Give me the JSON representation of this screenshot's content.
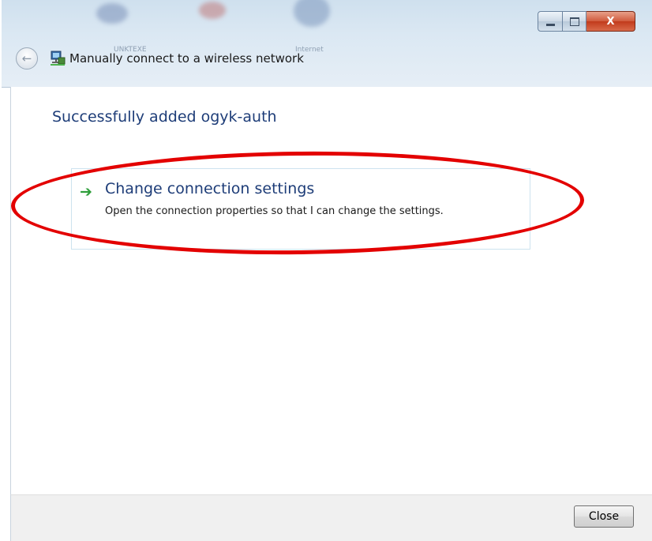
{
  "window": {
    "title": "Manually connect to a wireless network",
    "close_glyph": "X",
    "back_glyph": "←"
  },
  "background": {
    "label_left": "UNKTEXE",
    "label_right": "Internet"
  },
  "main": {
    "heading": "Successfully added ogyk-auth",
    "option": {
      "arrow_glyph": "➔",
      "title": "Change connection settings",
      "description": "Open the connection properties so that I can change the settings."
    }
  },
  "footer": {
    "close_label": "Close"
  },
  "colors": {
    "heading": "#1e3d78",
    "arrow": "#2e9e3a",
    "highlight": "#e30000"
  }
}
